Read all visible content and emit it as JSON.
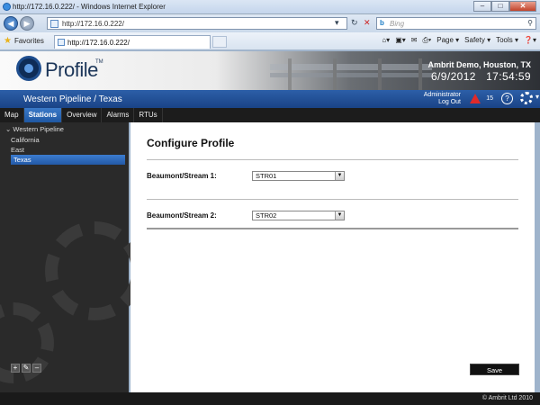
{
  "browser": {
    "window_title": "http://172.16.0.222/ - Windows Internet Explorer",
    "address": "http://172.16.0.222/",
    "search_placeholder": "Bing",
    "tab_title": "http://172.16.0.222/",
    "favorites_label": "Favorites",
    "page_menu": "Page ▾",
    "safety_menu": "Safety ▾",
    "tools_menu": "Tools ▾",
    "help_menu": "❓▾"
  },
  "header": {
    "logo_text": "Profile",
    "logo_tm": "TM",
    "site_label": "Ambrit Demo, Houston, TX",
    "date": "6/9/2012",
    "time": "17:54:59"
  },
  "breadcrumb": {
    "text": "Western Pipeline / Texas",
    "user_line1": "Administrator",
    "user_line2": "Log Out",
    "alarm_count": "15",
    "help_glyph": "?"
  },
  "nav": {
    "tabs": [
      {
        "label": "Map"
      },
      {
        "label": "Stations"
      },
      {
        "label": "Overview"
      },
      {
        "label": "Alarms"
      },
      {
        "label": "RTUs"
      }
    ]
  },
  "tree": {
    "root": "Western Pipeline",
    "children": [
      {
        "label": "California"
      },
      {
        "label": "East"
      },
      {
        "label": "Texas"
      }
    ]
  },
  "sidebar_tools": [
    "+",
    "✎",
    "–"
  ],
  "main": {
    "title": "Configure Profile",
    "fields": [
      {
        "label": "Beaumont/Stream 1:",
        "value": "STR01"
      },
      {
        "label": "Beaumont/Stream 2:",
        "value": "STR02"
      }
    ],
    "save_label": "Save"
  },
  "footer": {
    "copyright": "© Ambrit Ltd 2010"
  }
}
